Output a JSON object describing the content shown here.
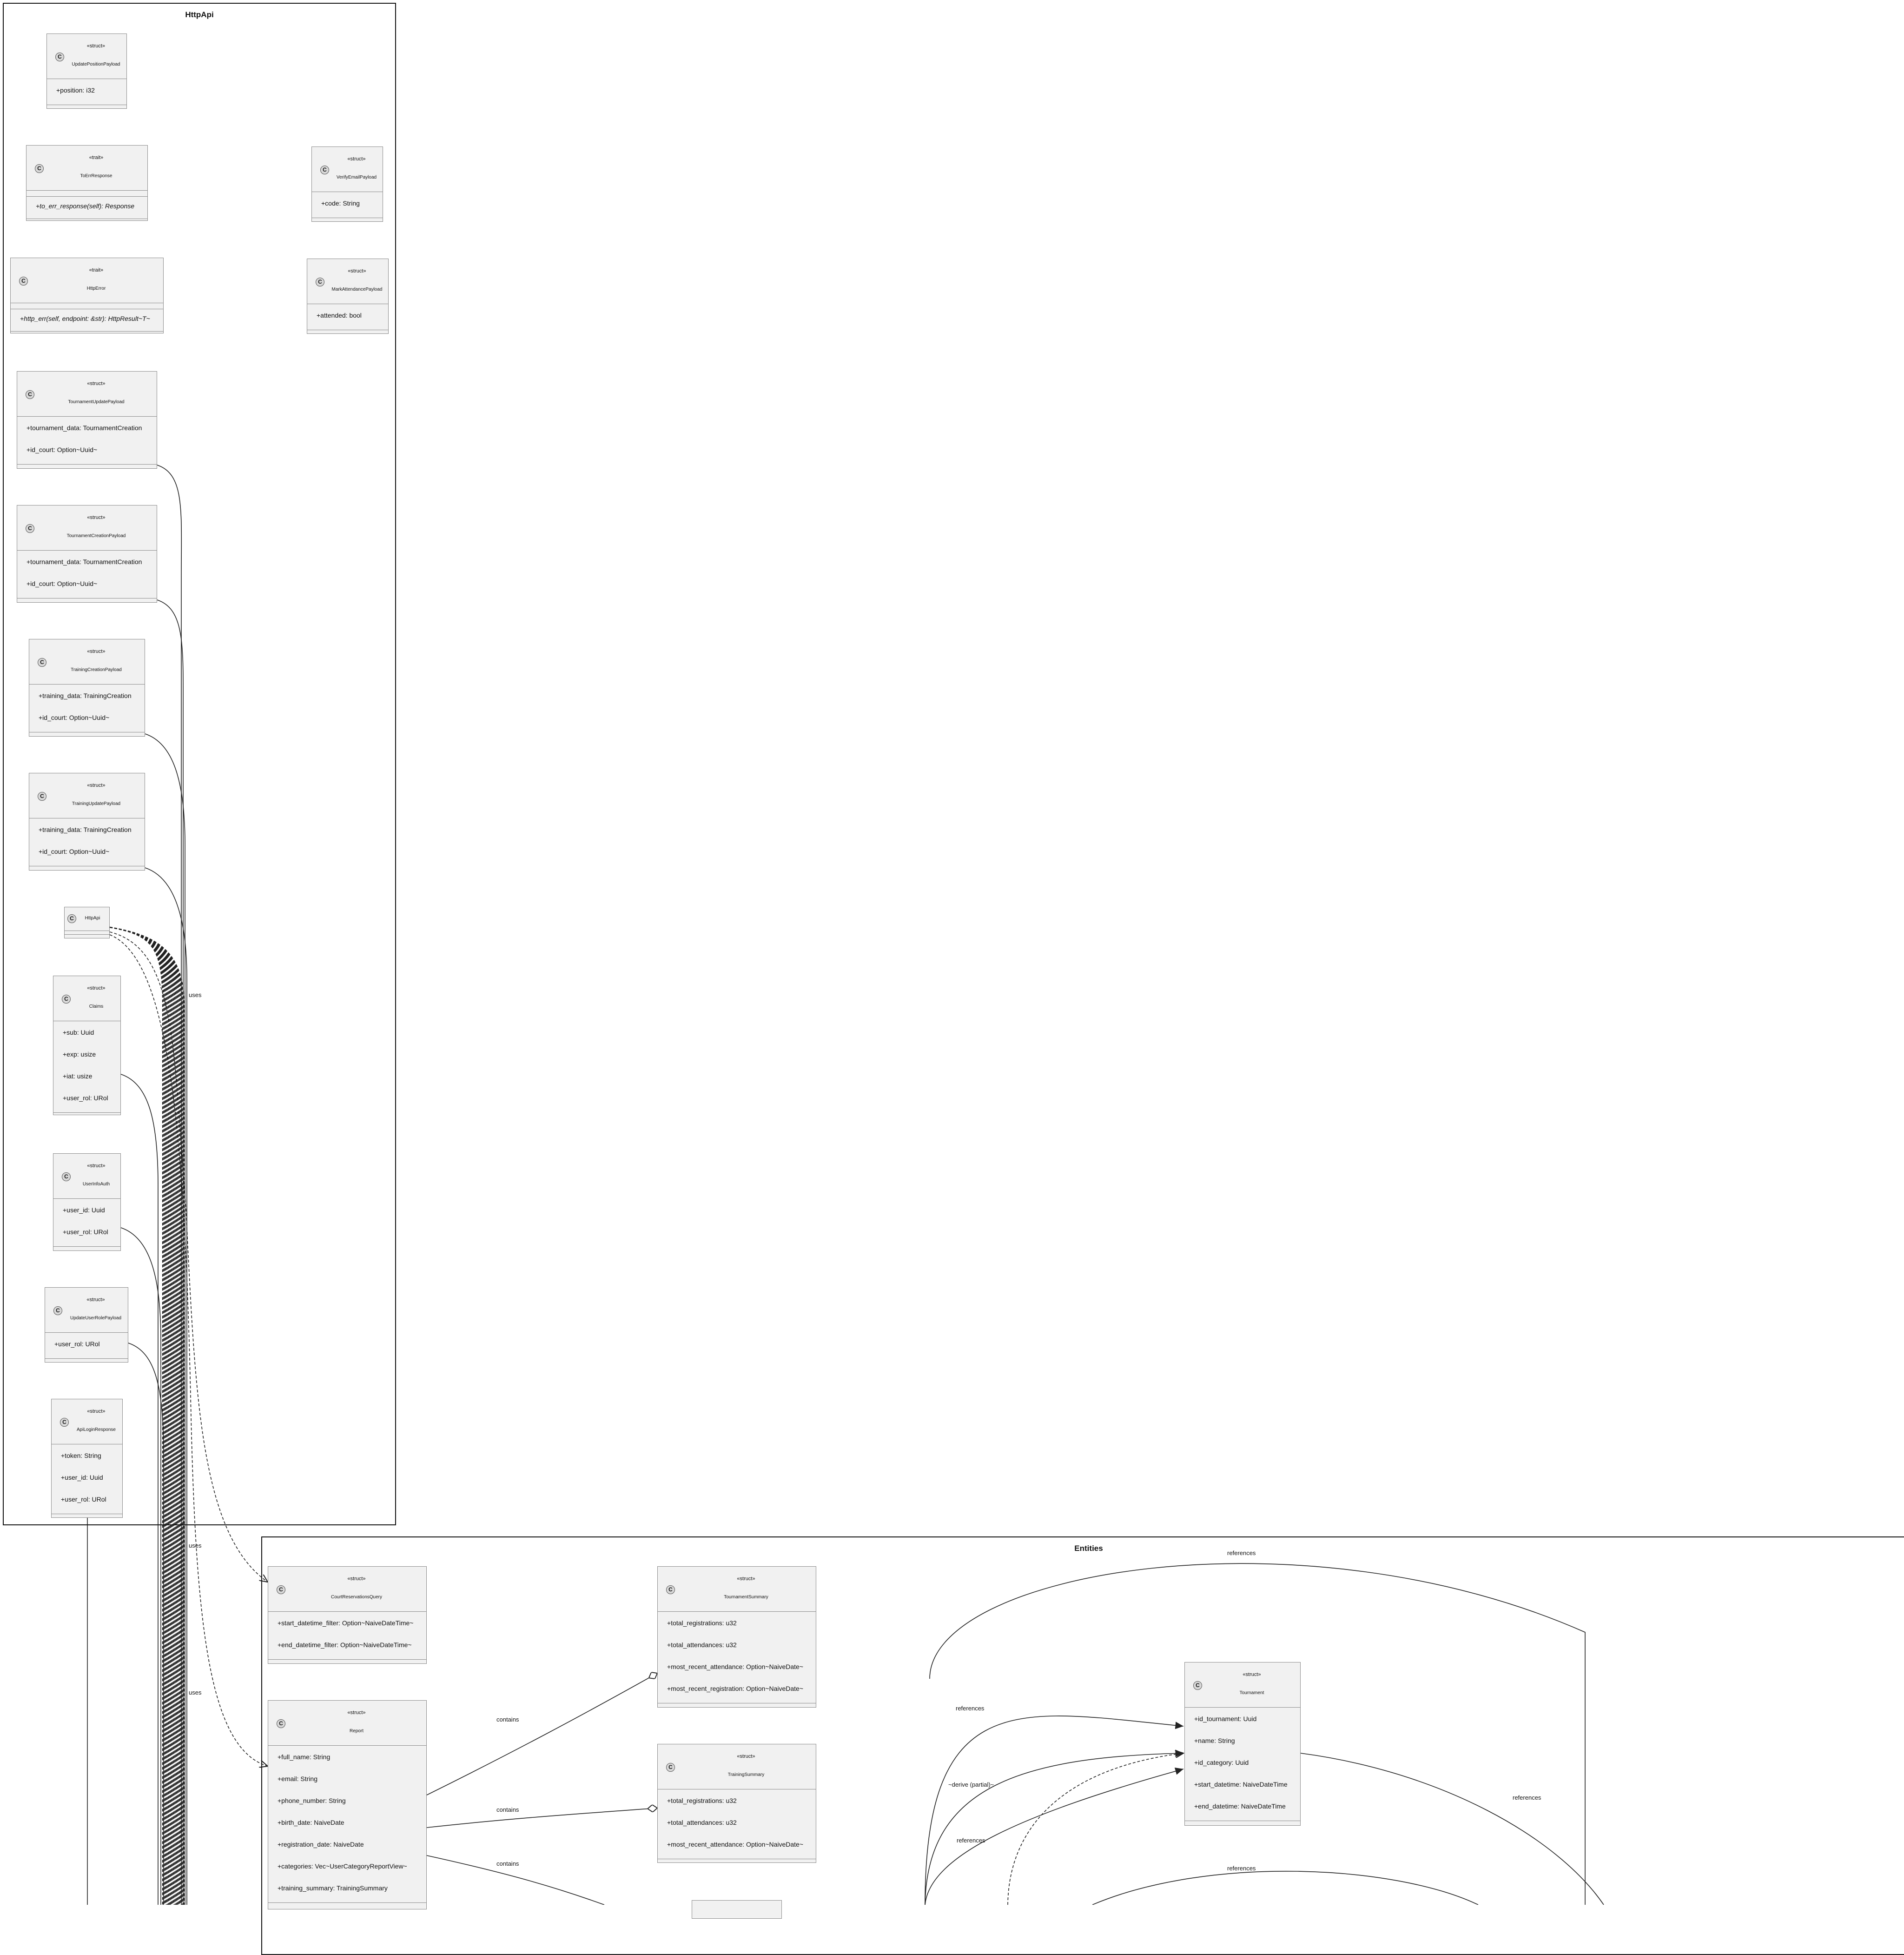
{
  "packages": {
    "httpapi": {
      "title": "HttpApi"
    },
    "entities": {
      "title": "Entities"
    }
  },
  "classes": {
    "update_position_payload": {
      "stereotype": "«struct»",
      "name": "UpdatePositionPayload",
      "fields": [
        "+position: i32"
      ]
    },
    "verify_email_payload": {
      "stereotype": "«struct»",
      "name": "VerifyEmailPayload",
      "fields": [
        "+code: String"
      ]
    },
    "to_err_response": {
      "stereotype": "«trait»",
      "name": "ToErrResponse",
      "methods": [
        "+to_err_response(self): Response"
      ]
    },
    "mark_attendance_payload": {
      "stereotype": "«struct»",
      "name": "MarkAttendancePayload",
      "fields": [
        "+attended: bool"
      ]
    },
    "http_error": {
      "stereotype": "«trait»",
      "name": "HttpError",
      "methods": [
        "+http_err(self, endpoint: &str): HttpResult~T~"
      ]
    },
    "tournament_update_payload": {
      "stereotype": "«struct»",
      "name": "TournamentUpdatePayload",
      "fields": [
        "+tournament_data: TournamentCreation",
        "+id_court: Option~Uuid~"
      ]
    },
    "tournament_creation_payload": {
      "stereotype": "«struct»",
      "name": "TournamentCreationPayload",
      "fields": [
        "+tournament_data: TournamentCreation",
        "+id_court: Option~Uuid~"
      ]
    },
    "training_creation_payload": {
      "stereotype": "«struct»",
      "name": "TrainingCreationPayload",
      "fields": [
        "+training_data: TrainingCreation",
        "+id_court: Option~Uuid~"
      ]
    },
    "training_update_payload": {
      "stereotype": "«struct»",
      "name": "TrainingUpdatePayload",
      "fields": [
        "+training_data: TrainingCreation",
        "+id_court: Option~Uuid~"
      ]
    },
    "http_api": {
      "name": "HttpApi"
    },
    "claims": {
      "stereotype": "«struct»",
      "name": "Claims",
      "fields": [
        "+sub: Uuid",
        "+exp: usize",
        "+iat: usize",
        "+user_rol: URol"
      ]
    },
    "user_info_auth": {
      "stereotype": "«struct»",
      "name": "UserInfoAuth",
      "fields": [
        "+user_id: Uuid",
        "+user_rol: URol"
      ]
    },
    "update_user_role_payload": {
      "stereotype": "«struct»",
      "name": "UpdateUserRolePayload",
      "fields": [
        "+user_rol: URol"
      ]
    },
    "api_login_response": {
      "stereotype": "«struct»",
      "name": "ApiLoginResponse",
      "fields": [
        "+token: String",
        "+user_id: Uuid",
        "+user_rol: URol"
      ]
    },
    "court_reservations_query": {
      "stereotype": "«struct»",
      "name": "CourtReservationsQuery",
      "fields": [
        "+start_datetime_filter: Option~NaiveDateTime~",
        "+end_datetime_filter: Option~NaiveDateTime~"
      ]
    },
    "tournament_summary": {
      "stereotype": "«struct»",
      "name": "TournamentSummary",
      "fields": [
        "+total_registrations: u32",
        "+total_attendances: u32",
        "+most_recent_attendance: Option~NaiveDate~",
        "+most_recent_registration: Option~NaiveDate~"
      ]
    },
    "tournament": {
      "stereotype": "«struct»",
      "name": "Tournament",
      "fields": [
        "+id_tournament: Uuid",
        "+name: String",
        "+id_category: Uuid",
        "+start_datetime: NaiveDateTime",
        "+end_datetime: NaiveDateTime"
      ]
    },
    "report": {
      "stereotype": "«struct»",
      "name": "Report",
      "fields": [
        "+full_name: String",
        "+email: String",
        "+phone_number: String",
        "+birth_date: NaiveDate",
        "+registration_date: NaiveDate",
        "+categories: Vec~UserCategoryReportView~",
        "+training_summary: TrainingSummary"
      ]
    },
    "training_summary": {
      "stereotype": "«struct»",
      "name": "TrainingSummary",
      "fields": [
        "+total_registrations: u32",
        "+total_attendances: u32",
        "+most_recent_attendance: Option~NaiveDate~"
      ]
    }
  },
  "edge_labels": {
    "uses_1": "uses",
    "uses_2": "uses",
    "uses_3": "uses",
    "references_1": "references",
    "references_2": "references",
    "references_3": "references",
    "references_4": "references",
    "references_5": "references",
    "derive_partial": "~derive (partial)~",
    "contains_1": "contains",
    "contains_2": "contains",
    "contains_3": "contains"
  }
}
